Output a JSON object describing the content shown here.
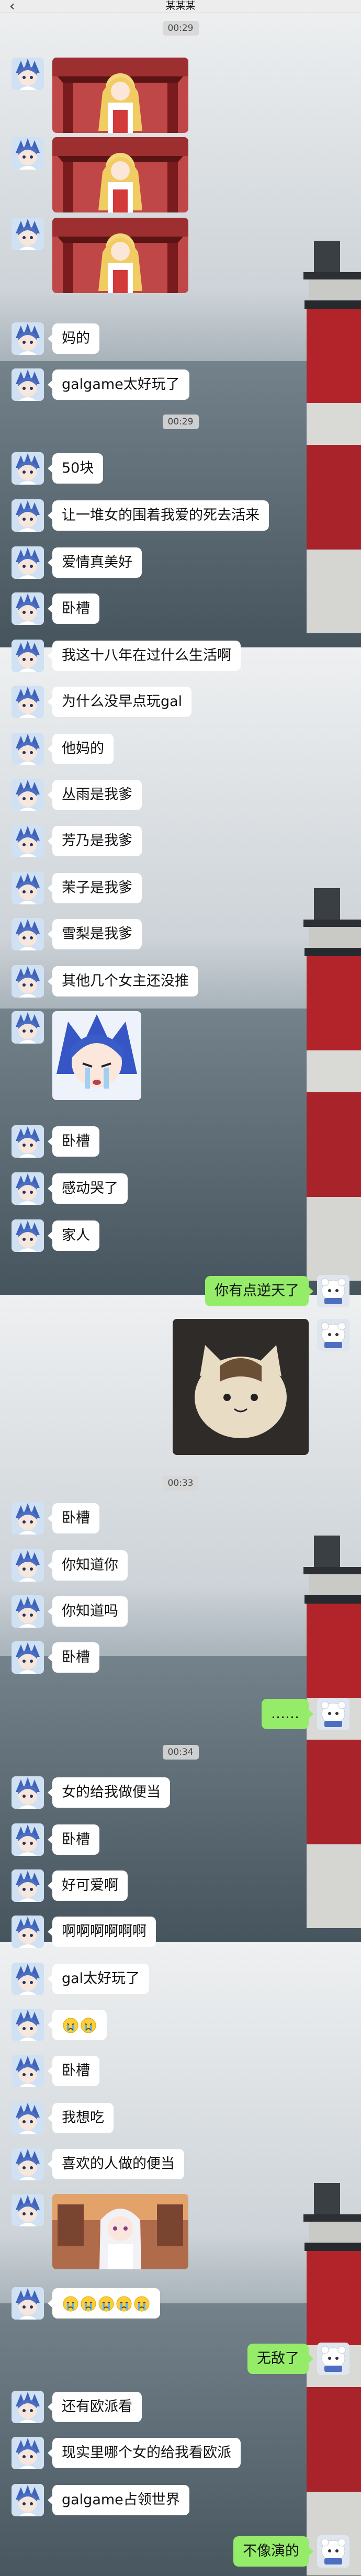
{
  "header": {
    "back_glyph": "‹",
    "title": "某某某"
  },
  "timestamps": [
    "00:29",
    "00:29",
    "00:33",
    "00:34"
  ],
  "colors": {
    "incoming_bubble": "#ffffff",
    "outgoing_bubble": "#95ec69",
    "timestamp_bg": "#d7d7d7"
  },
  "messages": [
    {
      "side": "left",
      "kind": "image",
      "image": "anime-girl-sticker"
    },
    {
      "side": "left",
      "kind": "image",
      "image": "anime-girl-sticker"
    },
    {
      "side": "left",
      "kind": "image",
      "image": "anime-girl-sticker"
    },
    {
      "side": "left",
      "kind": "text",
      "text": "妈的"
    },
    {
      "side": "left",
      "kind": "text",
      "text": "galgame太好玩了"
    },
    {
      "side": "left",
      "kind": "text",
      "text": "50块"
    },
    {
      "side": "left",
      "kind": "text",
      "text": "让一堆女的围着我爱的死去活来"
    },
    {
      "side": "left",
      "kind": "text",
      "text": "爱情真美好"
    },
    {
      "side": "left",
      "kind": "text",
      "text": "卧槽"
    },
    {
      "side": "left",
      "kind": "text",
      "text": "我这十八年在过什么生活啊"
    },
    {
      "side": "left",
      "kind": "text",
      "text": "为什么没早点玩gal"
    },
    {
      "side": "left",
      "kind": "text",
      "text": "他妈的"
    },
    {
      "side": "left",
      "kind": "text",
      "text": "丛雨是我爹"
    },
    {
      "side": "left",
      "kind": "text",
      "text": "芳乃是我爹"
    },
    {
      "side": "left",
      "kind": "text",
      "text": "茉子是我爹"
    },
    {
      "side": "left",
      "kind": "text",
      "text": "雪梨是我爹"
    },
    {
      "side": "left",
      "kind": "text",
      "text": "其他几个女主还没推"
    },
    {
      "side": "left",
      "kind": "image",
      "image": "crying-anime-girl-sticker"
    },
    {
      "side": "left",
      "kind": "text",
      "text": "卧槽"
    },
    {
      "side": "left",
      "kind": "text",
      "text": "感动哭了"
    },
    {
      "side": "left",
      "kind": "text",
      "text": "家人"
    },
    {
      "side": "right",
      "kind": "text",
      "text": "你有点逆天了"
    },
    {
      "side": "right",
      "kind": "image",
      "image": "cat-plush-sticker"
    },
    {
      "side": "left",
      "kind": "text",
      "text": "卧槽"
    },
    {
      "side": "left",
      "kind": "text",
      "text": "你知道你"
    },
    {
      "side": "left",
      "kind": "text",
      "text": "你知道吗"
    },
    {
      "side": "left",
      "kind": "text",
      "text": "卧槽"
    },
    {
      "side": "right",
      "kind": "text",
      "text": "……"
    },
    {
      "side": "left",
      "kind": "text",
      "text": "女的给我做便当"
    },
    {
      "side": "left",
      "kind": "text",
      "text": "卧槽"
    },
    {
      "side": "left",
      "kind": "text",
      "text": "好可爱啊"
    },
    {
      "side": "left",
      "kind": "text",
      "text": "啊啊啊啊啊啊"
    },
    {
      "side": "left",
      "kind": "text",
      "text": "gal太好玩了"
    },
    {
      "side": "left",
      "kind": "emoji",
      "emoji": "crying-face",
      "count": 2
    },
    {
      "side": "left",
      "kind": "text",
      "text": "卧槽"
    },
    {
      "side": "left",
      "kind": "text",
      "text": "我想吃"
    },
    {
      "side": "left",
      "kind": "text",
      "text": "喜欢的人做的便当"
    },
    {
      "side": "left",
      "kind": "image",
      "image": "white-hair-anime-girl"
    },
    {
      "side": "left",
      "kind": "emoji",
      "emoji": "crying-face",
      "count": 5
    },
    {
      "side": "right",
      "kind": "text",
      "text": "无敌了"
    },
    {
      "side": "left",
      "kind": "text",
      "text": "还有欧派看"
    },
    {
      "side": "left",
      "kind": "text",
      "text": "现实里哪个女的给我看欧派"
    },
    {
      "side": "left",
      "kind": "text",
      "text": "galgame占领世界"
    },
    {
      "side": "right",
      "kind": "text",
      "text": "不像演的"
    }
  ]
}
